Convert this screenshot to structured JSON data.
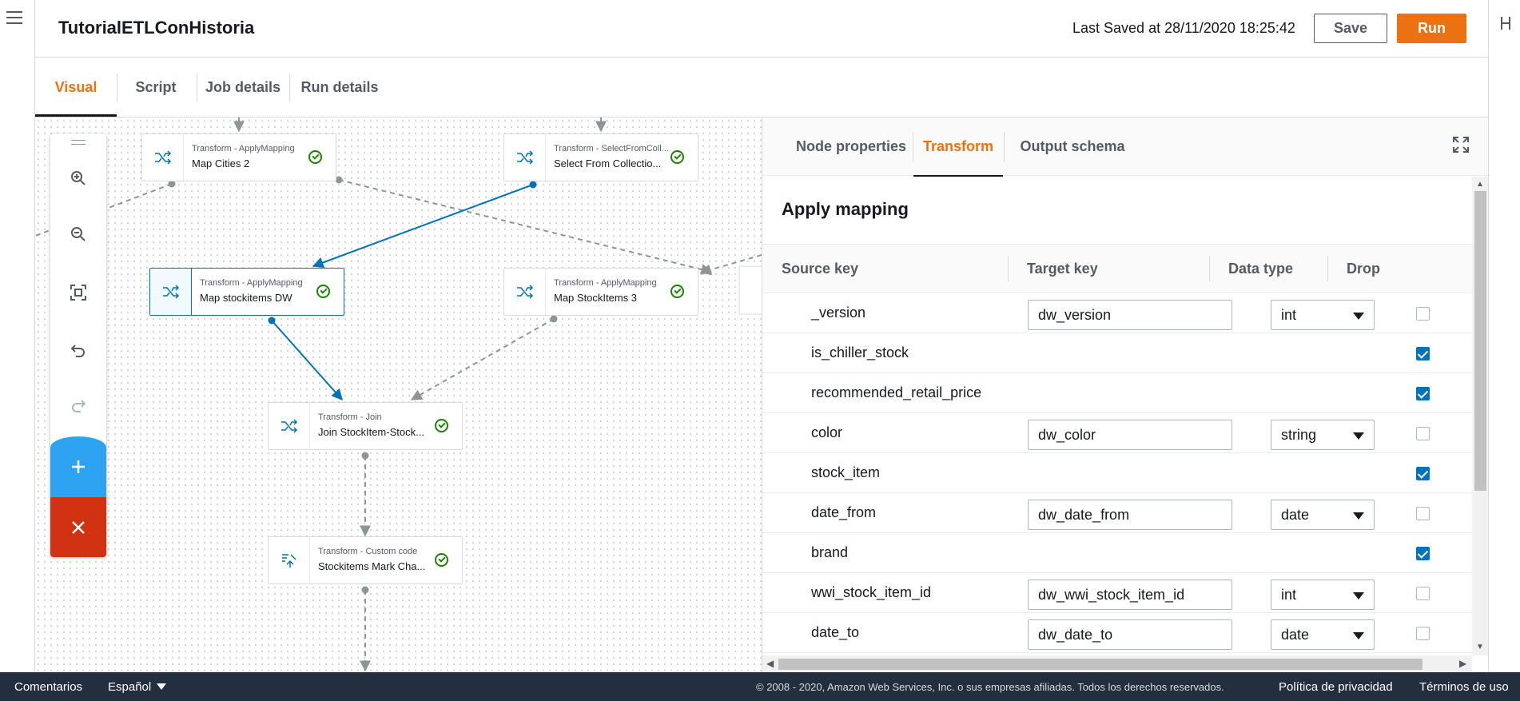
{
  "header": {
    "job_title": "TutorialETLConHistoria",
    "last_saved": "Last Saved at 28/11/2020 18:25:42",
    "save_label": "Save",
    "run_label": "Run"
  },
  "tabs": [
    {
      "label": "Visual",
      "active": true
    },
    {
      "label": "Script"
    },
    {
      "label": "Job details"
    },
    {
      "label": "Run details"
    }
  ],
  "nodes": [
    {
      "type": "Transform - ApplyMapping",
      "name": "Map Cities 2",
      "icon": "shuffle-icon",
      "status": "success"
    },
    {
      "type": "Transform - SelectFromColl...",
      "name": "Select From Collectio...",
      "icon": "shuffle-icon",
      "status": "success"
    },
    {
      "type": "Transform - ApplyMapping",
      "name": "Map stockitems DW",
      "icon": "shuffle-icon",
      "status": "success",
      "selected": true
    },
    {
      "type": "Transform - ApplyMapping",
      "name": "Map StockItems 3",
      "icon": "shuffle-icon",
      "status": "success"
    },
    {
      "type": "Transform - Join",
      "name": "Join StockItem-Stock...",
      "icon": "shuffle-icon",
      "status": "success"
    },
    {
      "type": "Transform - Custom code",
      "name": "Stockitems Mark Cha...",
      "icon": "custom-code-icon",
      "status": "success"
    }
  ],
  "canvas_toolbar": [
    "zoom-in-icon",
    "zoom-out-icon",
    "fit-to-screen-icon",
    "undo-icon",
    "redo-icon",
    "add-icon",
    "delete-icon"
  ],
  "panel": {
    "tabs": [
      {
        "label": "Node properties"
      },
      {
        "label": "Transform",
        "active": true
      },
      {
        "label": "Output schema"
      }
    ],
    "section_title": "Apply mapping",
    "columns": [
      "Source key",
      "Target key",
      "Data type",
      "Drop"
    ],
    "rows": [
      {
        "source": "_version",
        "target": "dw_version",
        "type": "int",
        "drop": false
      },
      {
        "source": "is_chiller_stock",
        "target": "",
        "type": "",
        "drop": true
      },
      {
        "source": "recommended_retail_price",
        "target": "",
        "type": "",
        "drop": true
      },
      {
        "source": "color",
        "target": "dw_color",
        "type": "string",
        "drop": false
      },
      {
        "source": "stock_item",
        "target": "",
        "type": "",
        "drop": true
      },
      {
        "source": "date_from",
        "target": "dw_date_from",
        "type": "date",
        "drop": false
      },
      {
        "source": "brand",
        "target": "",
        "type": "",
        "drop": true
      },
      {
        "source": "wwi_stock_item_id",
        "target": "dw_wwi_stock_item_id",
        "type": "int",
        "drop": false
      },
      {
        "source": "date_to",
        "target": "dw_date_to",
        "type": "date",
        "drop": false
      }
    ]
  },
  "footer": {
    "comments": "Comentarios",
    "language": "Español",
    "copyright": "© 2008 - 2020, Amazon Web Services, Inc. o sus empresas afiliadas. Todos los derechos reservados.",
    "privacy": "Política de privacidad",
    "terms": "Términos de uso"
  },
  "colors": {
    "accent": "#ec7211",
    "selected_edge": "#0073bb",
    "success": "#1d8102",
    "add_button": "#2ea3f2",
    "delete_button": "#d13212",
    "footer_bg": "#232f3e"
  }
}
